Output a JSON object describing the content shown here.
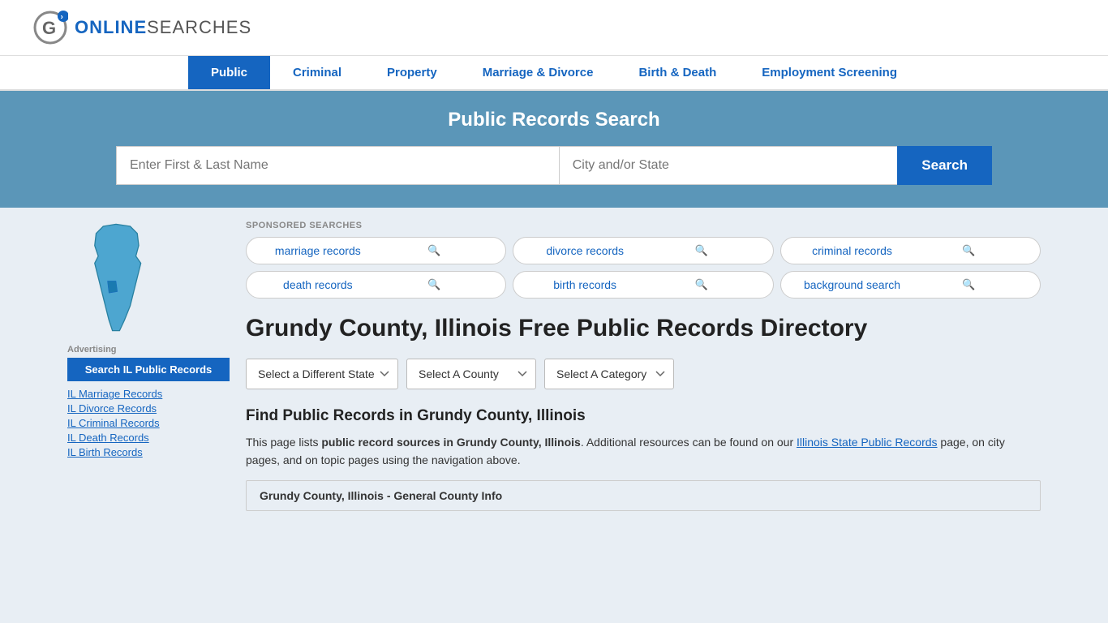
{
  "header": {
    "logo_online": "ONLINE",
    "logo_searches": "SEARCHES"
  },
  "nav": {
    "items": [
      {
        "label": "Public",
        "active": true
      },
      {
        "label": "Criminal",
        "active": false
      },
      {
        "label": "Property",
        "active": false
      },
      {
        "label": "Marriage & Divorce",
        "active": false
      },
      {
        "label": "Birth & Death",
        "active": false
      },
      {
        "label": "Employment Screening",
        "active": false
      }
    ]
  },
  "hero": {
    "title": "Public Records Search",
    "name_placeholder": "Enter First & Last Name",
    "city_placeholder": "City and/or State",
    "search_button": "Search"
  },
  "sponsored": {
    "label": "SPONSORED SEARCHES",
    "items": [
      {
        "text": "marriage records"
      },
      {
        "text": "divorce records"
      },
      {
        "text": "criminal records"
      },
      {
        "text": "death records"
      },
      {
        "text": "birth records"
      },
      {
        "text": "background search"
      }
    ]
  },
  "page": {
    "title": "Grundy County, Illinois Free Public Records Directory",
    "selects": {
      "state": "Select a Different State",
      "county": "Select A County",
      "category": "Select A Category"
    },
    "find_title": "Find Public Records in Grundy County, Illinois",
    "find_text_1": "This page lists ",
    "find_bold": "public record sources in Grundy County, Illinois",
    "find_text_2": ". Additional resources can be found on our ",
    "find_link": "Illinois State Public Records",
    "find_text_3": " page, on city pages, and on topic pages using the navigation above.",
    "county_info_bar": "Grundy County, Illinois - General County Info"
  },
  "sidebar": {
    "advertising_label": "Advertising",
    "ad_button": "Search IL Public Records",
    "links": [
      "IL Marriage Records",
      "IL Divorce Records",
      "IL Criminal Records",
      "IL Death Records",
      "IL Birth Records"
    ]
  }
}
